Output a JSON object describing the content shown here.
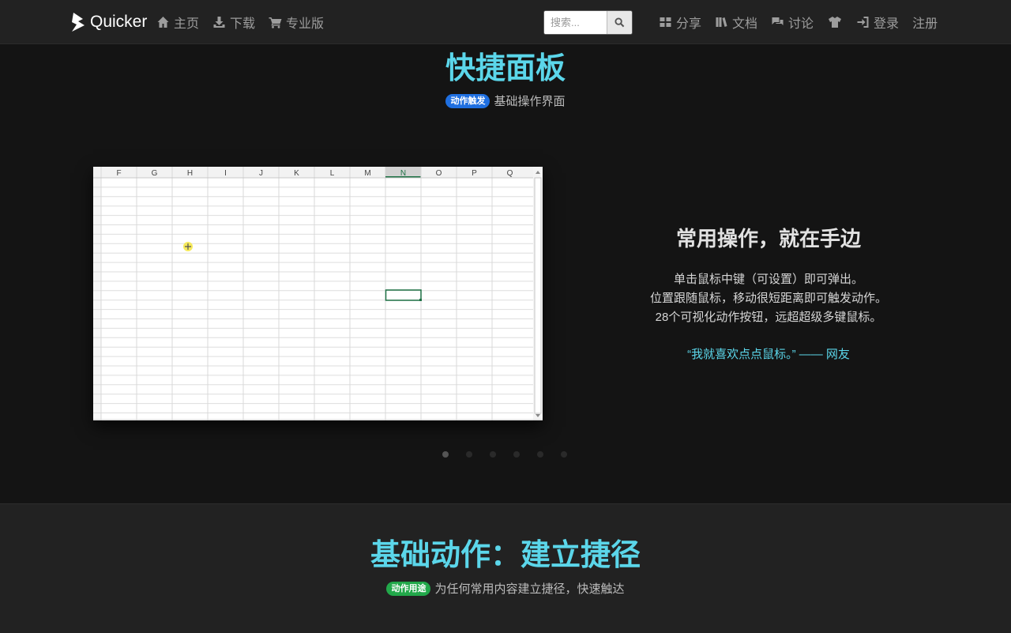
{
  "navbar": {
    "brand": "Quicker",
    "left_links": [
      {
        "label": "主页",
        "icon": "home-icon"
      },
      {
        "label": "下载",
        "icon": "download-icon"
      },
      {
        "label": "专业版",
        "icon": "cart-icon"
      }
    ],
    "search_placeholder": "搜索...",
    "right_links": [
      {
        "label": "分享",
        "icon": "grid-icon"
      },
      {
        "label": "文档",
        "icon": "books-icon"
      },
      {
        "label": "讨论",
        "icon": "comments-icon"
      },
      {
        "label": "",
        "icon": "tshirt-icon"
      },
      {
        "label": "登录",
        "icon": "sign-in-icon"
      },
      {
        "label": "注册",
        "icon": ""
      }
    ]
  },
  "section1": {
    "title": "快捷面板",
    "badge": "动作触发",
    "subtitle": "基础操作界面",
    "feature_title": "常用操作，就在手边",
    "feature_lines": [
      "单击鼠标中键（可设置）即可弹出。",
      "位置跟随鼠标，移动很短距离即可触发动作。",
      "28个可视化动作按钮，远超超级多键鼠标。"
    ],
    "quote": "“我就喜欢点点鼠标。” —— 网友",
    "spreadsheet": {
      "columns": [
        "F",
        "G",
        "H",
        "I",
        "J",
        "K",
        "L",
        "M",
        "N",
        "O",
        "P",
        "Q"
      ],
      "selected_column": "N"
    },
    "carousel_slides": 6,
    "carousel_active": 0
  },
  "section2": {
    "title": "基础动作：建立捷径",
    "badge": "动作用途",
    "subtitle": "为任何常用内容建立捷径，快速触达"
  },
  "colors": {
    "accent": "#5bd6ea",
    "badge_blue": "#1f6fe0",
    "badge_green": "#22a84a",
    "spreadsheet_selection": "#1e7145"
  }
}
